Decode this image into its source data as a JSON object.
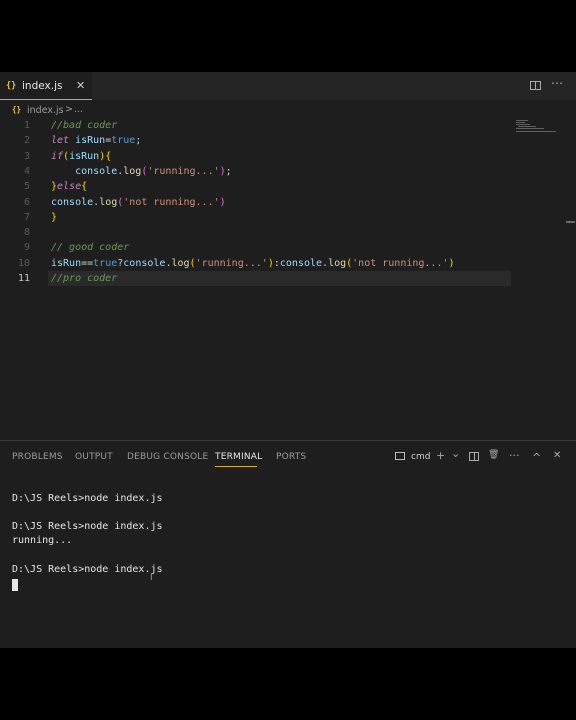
{
  "editor": {
    "tab": {
      "icon_text": "{}",
      "label": "index.js",
      "close": "✕"
    },
    "breadcrumb": {
      "file": "index.js",
      "sep": ">",
      "more": "..."
    },
    "code_lines": [
      {
        "n": "1",
        "tokens": [
          {
            "t": "//bad coder",
            "c": "c-comment"
          }
        ]
      },
      {
        "n": "2",
        "tokens": [
          {
            "t": "let ",
            "c": "c-kw"
          },
          {
            "t": "isRun",
            "c": "c-var"
          },
          {
            "t": "=",
            "c": "c-op"
          },
          {
            "t": "true",
            "c": "c-bool"
          },
          {
            "t": ";",
            "c": "c-op"
          }
        ]
      },
      {
        "n": "3",
        "tokens": [
          {
            "t": "if",
            "c": "c-kw"
          },
          {
            "t": "(",
            "c": "c-br"
          },
          {
            "t": "isRun",
            "c": "c-var"
          },
          {
            "t": ")",
            "c": "c-br"
          },
          {
            "t": "{",
            "c": "c-br"
          }
        ]
      },
      {
        "n": "4",
        "tokens": [
          {
            "t": "    console",
            "c": "c-var"
          },
          {
            "t": ".",
            "c": "c-op"
          },
          {
            "t": "log",
            "c": "c-fn"
          },
          {
            "t": "(",
            "c": "c-br2"
          },
          {
            "t": "'running...'",
            "c": "c-str"
          },
          {
            "t": ")",
            "c": "c-br2"
          },
          {
            "t": ";",
            "c": "c-op"
          }
        ]
      },
      {
        "n": "5",
        "tokens": [
          {
            "t": "}",
            "c": "c-br"
          },
          {
            "t": "else",
            "c": "c-kw"
          },
          {
            "t": "{",
            "c": "c-br"
          }
        ]
      },
      {
        "n": "6",
        "tokens": [
          {
            "t": "console",
            "c": "c-var"
          },
          {
            "t": ".",
            "c": "c-op"
          },
          {
            "t": "log",
            "c": "c-fn"
          },
          {
            "t": "(",
            "c": "c-br2"
          },
          {
            "t": "'not running...'",
            "c": "c-str"
          },
          {
            "t": ")",
            "c": "c-br2"
          }
        ]
      },
      {
        "n": "7",
        "tokens": [
          {
            "t": "}",
            "c": "c-br"
          }
        ]
      },
      {
        "n": "8",
        "tokens": []
      },
      {
        "n": "9",
        "tokens": [
          {
            "t": "// good coder",
            "c": "c-comment"
          }
        ]
      },
      {
        "n": "10",
        "tokens": [
          {
            "t": "isRun",
            "c": "c-var"
          },
          {
            "t": "==",
            "c": "c-op"
          },
          {
            "t": "true",
            "c": "c-bool"
          },
          {
            "t": "?",
            "c": "c-op"
          },
          {
            "t": "console",
            "c": "c-var"
          },
          {
            "t": ".",
            "c": "c-op"
          },
          {
            "t": "log",
            "c": "c-fn"
          },
          {
            "t": "(",
            "c": "c-br"
          },
          {
            "t": "'running...'",
            "c": "c-str"
          },
          {
            "t": ")",
            "c": "c-br"
          },
          {
            "t": ":",
            "c": "c-op"
          },
          {
            "t": "console",
            "c": "c-var"
          },
          {
            "t": ".",
            "c": "c-op"
          },
          {
            "t": "log",
            "c": "c-fn"
          },
          {
            "t": "(",
            "c": "c-br"
          },
          {
            "t": "'not running...'",
            "c": "c-str"
          },
          {
            "t": ")",
            "c": "c-br"
          }
        ]
      },
      {
        "n": "11",
        "tokens": [
          {
            "t": "//pro coder",
            "c": "c-comment"
          }
        ],
        "current": true
      }
    ]
  },
  "panel": {
    "tabs": [
      "PROBLEMS",
      "OUTPUT",
      "DEBUG CONSOLE",
      "TERMINAL",
      "PORTS"
    ],
    "active_tab": "TERMINAL",
    "terminal_label": "cmd",
    "icons": {
      "add": "+",
      "chevron": "⌄",
      "trash": "🗑",
      "more": "···",
      "maximize": "^",
      "close": "✕"
    },
    "terminal_lines": [
      "D:\\JS Reels>node index.js",
      "",
      "D:\\JS Reels>node index.js",
      "running...",
      "",
      "D:\\JS Reels>node index.js"
    ]
  },
  "colors": {
    "accent": "#d7a832",
    "editor_bg": "#1e1e1e"
  }
}
